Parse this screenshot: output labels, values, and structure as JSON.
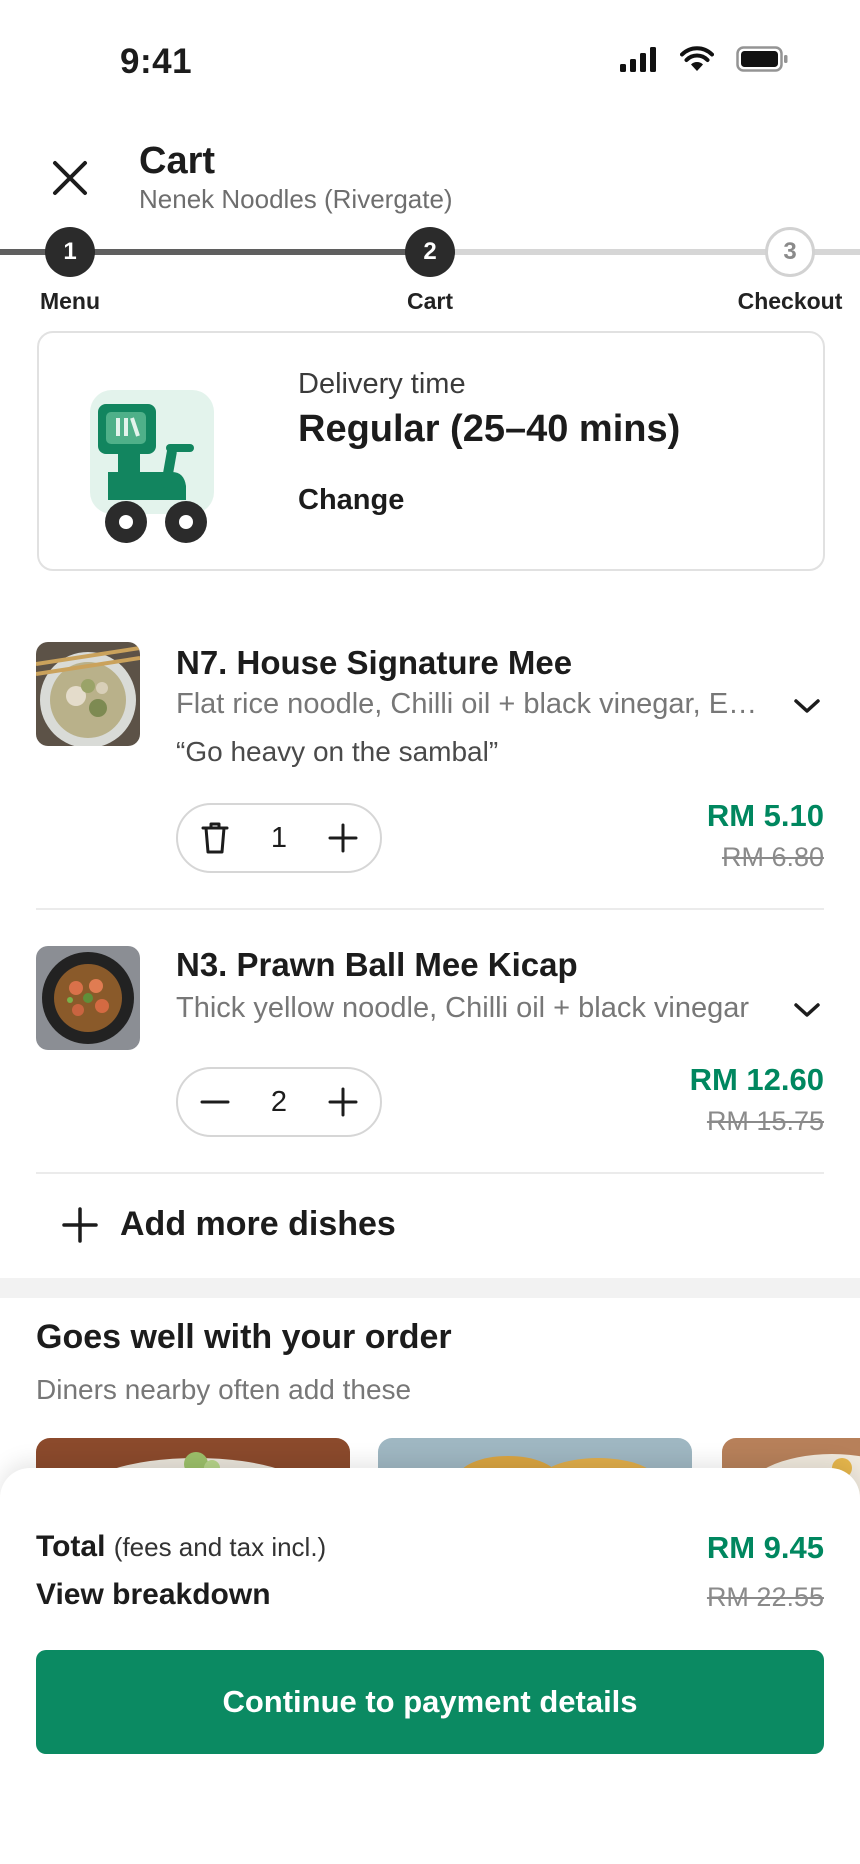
{
  "status_bar": {
    "time": "9:41"
  },
  "header": {
    "title": "Cart",
    "subtitle": "Nenek Noodles (Rivergate)"
  },
  "progress": {
    "current_step": 2,
    "steps": [
      {
        "number": "1",
        "label": "Menu"
      },
      {
        "number": "2",
        "label": "Cart"
      },
      {
        "number": "3",
        "label": "Checkout"
      }
    ]
  },
  "delivery": {
    "label": "Delivery time",
    "value": "Regular (25–40 mins)",
    "change_label": "Change"
  },
  "items": [
    {
      "name": "N7. House Signature Mee",
      "description": "Flat rice noodle, Chilli oil + black vinegar, Extra sambal",
      "note": "“Go heavy on the sambal”",
      "quantity": "1",
      "price": "RM 5.10",
      "original_price": "RM 6.80"
    },
    {
      "name": "N3. Prawn Ball Mee Kicap",
      "description": "Thick yellow noodle, Chilli oil + black vinegar",
      "quantity": "2",
      "price": "RM 12.60",
      "original_price": "RM 15.75"
    }
  ],
  "add_more_label": "Add more dishes",
  "recommendations": {
    "title": "Goes well with your order",
    "subtitle": "Diners nearby often add these"
  },
  "summary": {
    "total_label": "Total",
    "total_note": "(fees and tax incl.)",
    "breakdown_label": "View breakdown",
    "total_price": "RM 9.45",
    "original_total": "RM 22.55"
  },
  "cta_label": "Continue to payment details",
  "colors": {
    "accent": "#0b8a62",
    "price": "#00875f",
    "dark": "#2b2b2b"
  }
}
